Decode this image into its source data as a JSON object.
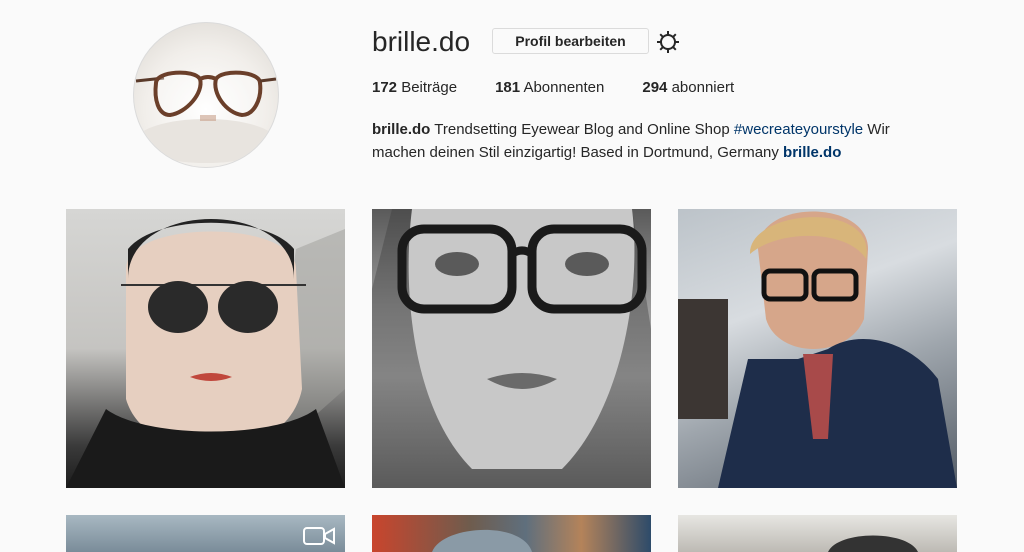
{
  "profile": {
    "username": "brille.do",
    "edit_button": "Profil bearbeiten",
    "settings_icon": "gear-icon",
    "avatar_icon": "glasses-avatar"
  },
  "stats": {
    "posts_count": "172",
    "posts_label": "Beiträge",
    "followers_count": "181",
    "followers_label": "Abonnenten",
    "following_count": "294",
    "following_label": "abonniert"
  },
  "bio": {
    "name": "brille.do",
    "text_1": "Trendsetting Eyewear Blog and Online Shop",
    "hashtag": "#wecreateyourstyle",
    "text_2": "Wir machen deinen Stil einzigartig! Based in Dortmund, Germany",
    "website": "brille.do"
  },
  "grid": {
    "items": [
      {
        "name": "woman-round-sunglasses"
      },
      {
        "name": "woman-black-frame-glasses-bw"
      },
      {
        "name": "man-blue-jacket-glasses"
      },
      {
        "name": "man-glasses-video",
        "icon": "video-icon"
      },
      {
        "name": "man-cap-colorful-background"
      },
      {
        "name": "man-bw-portrait"
      }
    ]
  },
  "colors": {
    "background": "#fafafa",
    "text": "#262626",
    "link": "#003569",
    "border": "#dbdbdb"
  }
}
